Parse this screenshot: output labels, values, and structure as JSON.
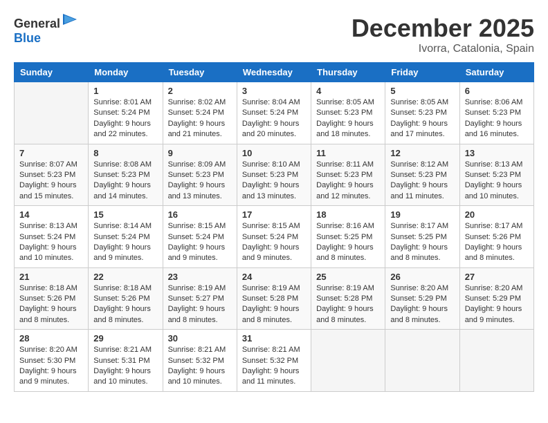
{
  "logo": {
    "general": "General",
    "blue": "Blue"
  },
  "header": {
    "month_title": "December 2025",
    "location": "Ivorra, Catalonia, Spain"
  },
  "weekdays": [
    "Sunday",
    "Monday",
    "Tuesday",
    "Wednesday",
    "Thursday",
    "Friday",
    "Saturday"
  ],
  "weeks": [
    [
      {
        "day": "",
        "sunrise": "",
        "sunset": "",
        "daylight": ""
      },
      {
        "day": "1",
        "sunrise": "Sunrise: 8:01 AM",
        "sunset": "Sunset: 5:24 PM",
        "daylight": "Daylight: 9 hours and 22 minutes."
      },
      {
        "day": "2",
        "sunrise": "Sunrise: 8:02 AM",
        "sunset": "Sunset: 5:24 PM",
        "daylight": "Daylight: 9 hours and 21 minutes."
      },
      {
        "day": "3",
        "sunrise": "Sunrise: 8:04 AM",
        "sunset": "Sunset: 5:24 PM",
        "daylight": "Daylight: 9 hours and 20 minutes."
      },
      {
        "day": "4",
        "sunrise": "Sunrise: 8:05 AM",
        "sunset": "Sunset: 5:23 PM",
        "daylight": "Daylight: 9 hours and 18 minutes."
      },
      {
        "day": "5",
        "sunrise": "Sunrise: 8:05 AM",
        "sunset": "Sunset: 5:23 PM",
        "daylight": "Daylight: 9 hours and 17 minutes."
      },
      {
        "day": "6",
        "sunrise": "Sunrise: 8:06 AM",
        "sunset": "Sunset: 5:23 PM",
        "daylight": "Daylight: 9 hours and 16 minutes."
      }
    ],
    [
      {
        "day": "7",
        "sunrise": "Sunrise: 8:07 AM",
        "sunset": "Sunset: 5:23 PM",
        "daylight": "Daylight: 9 hours and 15 minutes."
      },
      {
        "day": "8",
        "sunrise": "Sunrise: 8:08 AM",
        "sunset": "Sunset: 5:23 PM",
        "daylight": "Daylight: 9 hours and 14 minutes."
      },
      {
        "day": "9",
        "sunrise": "Sunrise: 8:09 AM",
        "sunset": "Sunset: 5:23 PM",
        "daylight": "Daylight: 9 hours and 13 minutes."
      },
      {
        "day": "10",
        "sunrise": "Sunrise: 8:10 AM",
        "sunset": "Sunset: 5:23 PM",
        "daylight": "Daylight: 9 hours and 13 minutes."
      },
      {
        "day": "11",
        "sunrise": "Sunrise: 8:11 AM",
        "sunset": "Sunset: 5:23 PM",
        "daylight": "Daylight: 9 hours and 12 minutes."
      },
      {
        "day": "12",
        "sunrise": "Sunrise: 8:12 AM",
        "sunset": "Sunset: 5:23 PM",
        "daylight": "Daylight: 9 hours and 11 minutes."
      },
      {
        "day": "13",
        "sunrise": "Sunrise: 8:13 AM",
        "sunset": "Sunset: 5:23 PM",
        "daylight": "Daylight: 9 hours and 10 minutes."
      }
    ],
    [
      {
        "day": "14",
        "sunrise": "Sunrise: 8:13 AM",
        "sunset": "Sunset: 5:24 PM",
        "daylight": "Daylight: 9 hours and 10 minutes."
      },
      {
        "day": "15",
        "sunrise": "Sunrise: 8:14 AM",
        "sunset": "Sunset: 5:24 PM",
        "daylight": "Daylight: 9 hours and 9 minutes."
      },
      {
        "day": "16",
        "sunrise": "Sunrise: 8:15 AM",
        "sunset": "Sunset: 5:24 PM",
        "daylight": "Daylight: 9 hours and 9 minutes."
      },
      {
        "day": "17",
        "sunrise": "Sunrise: 8:15 AM",
        "sunset": "Sunset: 5:24 PM",
        "daylight": "Daylight: 9 hours and 9 minutes."
      },
      {
        "day": "18",
        "sunrise": "Sunrise: 8:16 AM",
        "sunset": "Sunset: 5:25 PM",
        "daylight": "Daylight: 9 hours and 8 minutes."
      },
      {
        "day": "19",
        "sunrise": "Sunrise: 8:17 AM",
        "sunset": "Sunset: 5:25 PM",
        "daylight": "Daylight: 9 hours and 8 minutes."
      },
      {
        "day": "20",
        "sunrise": "Sunrise: 8:17 AM",
        "sunset": "Sunset: 5:26 PM",
        "daylight": "Daylight: 9 hours and 8 minutes."
      }
    ],
    [
      {
        "day": "21",
        "sunrise": "Sunrise: 8:18 AM",
        "sunset": "Sunset: 5:26 PM",
        "daylight": "Daylight: 9 hours and 8 minutes."
      },
      {
        "day": "22",
        "sunrise": "Sunrise: 8:18 AM",
        "sunset": "Sunset: 5:26 PM",
        "daylight": "Daylight: 9 hours and 8 minutes."
      },
      {
        "day": "23",
        "sunrise": "Sunrise: 8:19 AM",
        "sunset": "Sunset: 5:27 PM",
        "daylight": "Daylight: 9 hours and 8 minutes."
      },
      {
        "day": "24",
        "sunrise": "Sunrise: 8:19 AM",
        "sunset": "Sunset: 5:28 PM",
        "daylight": "Daylight: 9 hours and 8 minutes."
      },
      {
        "day": "25",
        "sunrise": "Sunrise: 8:19 AM",
        "sunset": "Sunset: 5:28 PM",
        "daylight": "Daylight: 9 hours and 8 minutes."
      },
      {
        "day": "26",
        "sunrise": "Sunrise: 8:20 AM",
        "sunset": "Sunset: 5:29 PM",
        "daylight": "Daylight: 9 hours and 8 minutes."
      },
      {
        "day": "27",
        "sunrise": "Sunrise: 8:20 AM",
        "sunset": "Sunset: 5:29 PM",
        "daylight": "Daylight: 9 hours and 9 minutes."
      }
    ],
    [
      {
        "day": "28",
        "sunrise": "Sunrise: 8:20 AM",
        "sunset": "Sunset: 5:30 PM",
        "daylight": "Daylight: 9 hours and 9 minutes."
      },
      {
        "day": "29",
        "sunrise": "Sunrise: 8:21 AM",
        "sunset": "Sunset: 5:31 PM",
        "daylight": "Daylight: 9 hours and 10 minutes."
      },
      {
        "day": "30",
        "sunrise": "Sunrise: 8:21 AM",
        "sunset": "Sunset: 5:32 PM",
        "daylight": "Daylight: 9 hours and 10 minutes."
      },
      {
        "day": "31",
        "sunrise": "Sunrise: 8:21 AM",
        "sunset": "Sunset: 5:32 PM",
        "daylight": "Daylight: 9 hours and 11 minutes."
      },
      {
        "day": "",
        "sunrise": "",
        "sunset": "",
        "daylight": ""
      },
      {
        "day": "",
        "sunrise": "",
        "sunset": "",
        "daylight": ""
      },
      {
        "day": "",
        "sunrise": "",
        "sunset": "",
        "daylight": ""
      }
    ]
  ]
}
